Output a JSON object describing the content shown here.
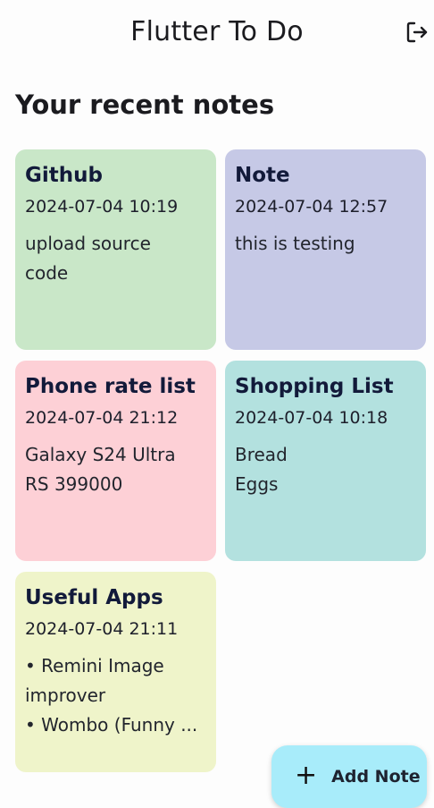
{
  "app_bar": {
    "title": "Flutter To Do",
    "logout_icon": "logout-icon"
  },
  "section": {
    "title": "Your recent notes"
  },
  "notes": [
    {
      "title": "Github",
      "date": "2024-07-04 10:19",
      "body_lines": [
        "upload source",
        "code"
      ],
      "color": "#c9e7c8"
    },
    {
      "title": "Note",
      "date": "2024-07-04 12:57",
      "body_lines": [
        "this is testing"
      ],
      "color": "#c6c9e6"
    },
    {
      "title": "Phone rate list",
      "date": "2024-07-04 21:12",
      "body_lines": [
        "Galaxy S24 Ultra",
        "RS 399000"
      ],
      "color": "#fdd0d6"
    },
    {
      "title": "Shopping List",
      "date": "2024-07-04 10:18",
      "body_lines": [
        "Bread",
        "Eggs"
      ],
      "color": "#b3e1df"
    },
    {
      "title": "Useful Apps",
      "date": "2024-07-04 21:11",
      "body_lines": [
        "• Remini Image",
        "improver",
        "• Wombo (Funny ..."
      ],
      "color": "#eff4ca"
    }
  ],
  "fab": {
    "icon": "plus-icon",
    "label": "Add Note",
    "color": "#a8ecfa"
  }
}
